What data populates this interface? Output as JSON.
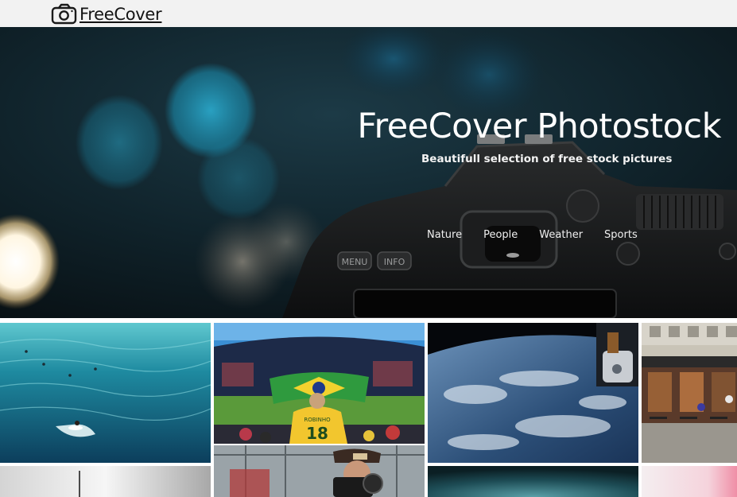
{
  "brand": {
    "name": "FreeCover",
    "icon": "camera-icon"
  },
  "hero": {
    "title": "FreeCover Photostock",
    "subtitle": "Beautifull selection of free stock pictures",
    "camera_labels": {
      "menu": "MENU",
      "info": "INFO"
    },
    "nav": [
      {
        "label": "Nature"
      },
      {
        "label": "People"
      },
      {
        "label": "Weather"
      },
      {
        "label": "Sports"
      }
    ]
  },
  "gallery": {
    "tiles": [
      {
        "subject": "surfers in ocean"
      },
      {
        "subject": "football fan with Brazil flag in stadium",
        "shirt_text": "ROBINHO",
        "shirt_number": "18"
      },
      {
        "subject": "earth from space station"
      },
      {
        "subject": "street cafe"
      },
      {
        "subject": "grey foggy pole"
      },
      {
        "subject": "photographer with camera"
      },
      {
        "subject": "teal abstract"
      },
      {
        "subject": "pink blur"
      }
    ]
  },
  "colors": {
    "topbar_bg": "#f2f2f2",
    "hero_text": "#ffffff",
    "ocean": "#1e8aa0",
    "stadium_grass": "#5a9a3a",
    "flag_green": "#2f9a3e",
    "flag_yellow": "#f2d22e"
  }
}
